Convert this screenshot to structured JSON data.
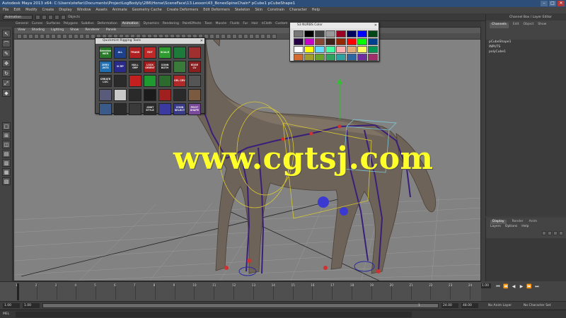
{
  "app": {
    "title": "Autodesk Maya 2013 x64: C:\\Users\\stefan\\Documents\\ProjectLogBodyly\\286\\Horse\\SceneFace\\13.Lesson\\43_BonesSpineChain*   pCube1 pCubeShape1"
  },
  "menubar": [
    "File",
    "Edit",
    "Modify",
    "Create",
    "Display",
    "Window",
    "Assets",
    "Animate",
    "Geometry Cache",
    "Create Deformers",
    "Edit Deformers",
    "Skeleton",
    "Skin",
    "Constrain",
    "Character",
    "Help"
  ],
  "statusline": {
    "mode": "Animation",
    "object_label": "Objects"
  },
  "shelf": {
    "tabs": [
      "General",
      "Curves",
      "Surfaces",
      "Polygons",
      "Subdivs",
      "Deformation",
      "Animation",
      "Dynamics",
      "Rendering",
      "PaintEffects",
      "Toon",
      "Muscle",
      "Fluids",
      "Fur",
      "Hair",
      "nCloth",
      "Custom"
    ],
    "active_tab": "Animation"
  },
  "toolbox": {
    "tools": [
      {
        "name": "select-tool",
        "glyph": "↖"
      },
      {
        "name": "lasso-tool",
        "glyph": "⌒"
      },
      {
        "name": "paint-select-tool",
        "glyph": "✎"
      },
      {
        "name": "move-tool",
        "glyph": "✥"
      },
      {
        "name": "rotate-tool",
        "glyph": "↻"
      },
      {
        "name": "scale-tool",
        "glyph": "⤢"
      },
      {
        "name": "last-tool",
        "glyph": "◆"
      },
      {
        "name": "layout-single",
        "glyph": "□"
      },
      {
        "name": "layout-four",
        "glyph": "⊞"
      },
      {
        "name": "layout-two",
        "glyph": "◫"
      },
      {
        "name": "layout-persp-outliner",
        "glyph": "▤"
      },
      {
        "name": "layout-graph",
        "glyph": "▥"
      },
      {
        "name": "layout-hypershade",
        "glyph": "▦"
      },
      {
        "name": "layout-custom",
        "glyph": "▧"
      }
    ]
  },
  "viewport": {
    "menu": [
      "View",
      "Shading",
      "Lighting",
      "Show",
      "Renderer",
      "Panels"
    ],
    "watermark": "www.cgtsj.com"
  },
  "rigging_window": {
    "title": "Quickmint Rigging Tools",
    "close_glyph": "✕",
    "buttons": [
      {
        "label": "Selection HIER",
        "color": "#2b7a2b"
      },
      {
        "label": "ALL",
        "color": "#1e3f8a"
      },
      {
        "label": "TRANS",
        "color": "#b02020"
      },
      {
        "label": "ROT",
        "color": "#c02727"
      },
      {
        "label": "SCALE",
        "color": "#2f9a2f"
      },
      {
        "label": "",
        "color": "#1d7a3a"
      },
      {
        "label": "",
        "color": "#a03030"
      },
      {
        "label": "ZERO JNTS",
        "color": "#1f6fb0"
      },
      {
        "label": "IK RP",
        "color": "#2a2a8a"
      },
      {
        "label": "NULL GRP",
        "color": "#303030"
      },
      {
        "label": "LOCK ORIENT",
        "color": "#a01c1c"
      },
      {
        "label": "CONN BOTH",
        "color": "#2a2a2a"
      },
      {
        "label": "",
        "color": "#3a7a3a"
      },
      {
        "label": "EDGE CV",
        "color": "#8a1f1f"
      },
      {
        "label": "CREATE LOC",
        "color": "#333333"
      },
      {
        "label": "",
        "color": "#2a2a2a"
      },
      {
        "label": "",
        "color": "#c42020"
      },
      {
        "label": "",
        "color": "#1f9a30"
      },
      {
        "label": "",
        "color": "#2d6a2d"
      },
      {
        "label": "DEL CRV",
        "color": "#b02a2a"
      },
      {
        "label": "",
        "color": "#555555"
      },
      {
        "label": "",
        "color": "#5a5a7a"
      },
      {
        "label": "",
        "color": "#c8c8c8"
      },
      {
        "label": "",
        "color": "#2a2a2a"
      },
      {
        "label": "",
        "color": "#1a1a1a"
      },
      {
        "label": "",
        "color": "#a02020"
      },
      {
        "label": "",
        "color": "#2a2a2a"
      },
      {
        "label": "",
        "color": "#7a5a40"
      },
      {
        "label": "",
        "color": "#3a5a8a"
      },
      {
        "label": "",
        "color": "#2a2a2a"
      },
      {
        "label": "",
        "color": "#3a3a3a"
      },
      {
        "label": "JOINT STYLE",
        "color": "#2a2a2a"
      },
      {
        "label": "",
        "color": "#3a3aa0"
      },
      {
        "label": "CONN SELECT",
        "color": "#3a3a8a"
      },
      {
        "label": "PIVOT SHAPE",
        "color": "#7a4a9a"
      }
    ]
  },
  "color_window": {
    "title": "S3 NURBS Color",
    "close_glyph": "✕",
    "colors": [
      "#777777",
      "#000000",
      "#3f3f3f",
      "#999999",
      "#9b0024",
      "#00015f",
      "#0000fe",
      "#004618",
      "#250043",
      "#c700c7",
      "#894733",
      "#3e2119",
      "#962500",
      "#ff0000",
      "#00ff00",
      "#00418d",
      "#ffffff",
      "#ffff00",
      "#63dcff",
      "#43ffa2",
      "#ffafaf",
      "#e2ac78",
      "#ffff61",
      "#009755",
      "#d36b2e",
      "#a19e2b",
      "#68a12b",
      "#2ea15e",
      "#2ea1a1",
      "#2e66a1",
      "#6e2ea1",
      "#a12e6b"
    ]
  },
  "channel_box": {
    "title": "Channel Box / Layer Editor",
    "tabs": [
      "Channels",
      "Edit",
      "Object",
      "Show"
    ],
    "lines": [
      "pCubeShape1",
      "INPUTS",
      "polyCube1"
    ]
  },
  "layer_editor": {
    "tabs": [
      "Display",
      "Render",
      "Anim"
    ],
    "menus": [
      "Layers",
      "Options",
      "Help"
    ]
  },
  "timeslider": {
    "ticks": [
      "1",
      "2",
      "3",
      "4",
      "5",
      "6",
      "7",
      "8",
      "9",
      "10",
      "11",
      "12",
      "13",
      "14",
      "15",
      "16",
      "17",
      "18",
      "19",
      "20",
      "21",
      "22",
      "23",
      "24"
    ],
    "current_frame": "1.00",
    "play_glyphs": [
      "⏮",
      "⏪",
      "◀",
      "▶",
      "⏩",
      "⏭"
    ]
  },
  "range": {
    "start": "1.00",
    "start2": "1.00",
    "end": "24.00",
    "end2": "48.00",
    "end_display": "1",
    "anim_layer": "No Anim Layer",
    "char_set": "No Character Set"
  },
  "command_line": {
    "label": "MEL",
    "value": ""
  }
}
